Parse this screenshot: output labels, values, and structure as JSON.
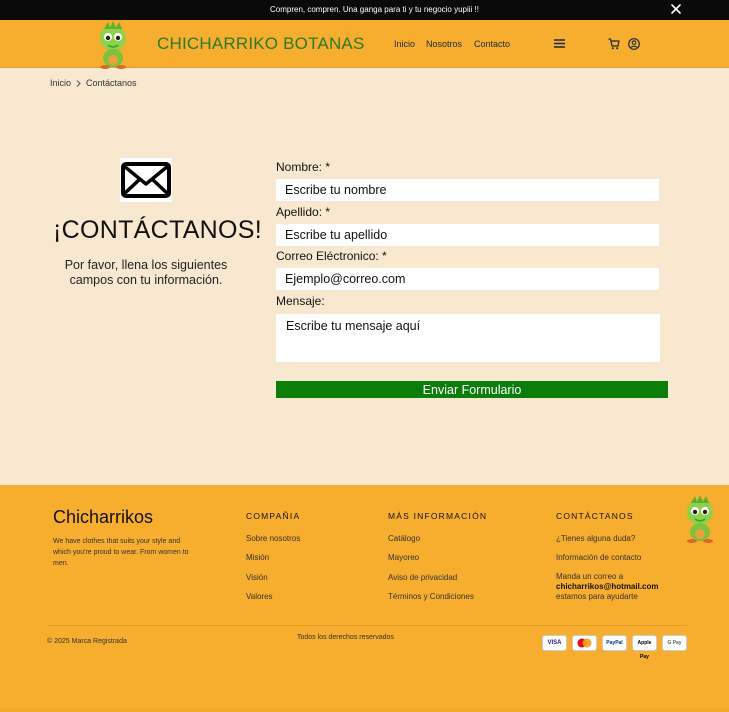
{
  "announcement": {
    "text": "Compren, compren. Una ganga para ti y tu negocio yupiii !!"
  },
  "header": {
    "brand": "CHICHARRIKO BOTANAS",
    "nav": [
      "Inicio",
      "Nosotros",
      "Contacto"
    ]
  },
  "breadcrumb": {
    "home": "Inicio",
    "current": "Contáctanos"
  },
  "contact": {
    "title": "¡CONTÁCTANOS!",
    "subtitle": "Por favor, llena los siguientes campos con tu información."
  },
  "form": {
    "name_label": "Nombre: *",
    "name_placeholder": "Escribe tu nombre",
    "lastname_label": "Apellido: *",
    "lastname_placeholder": "Escribe tu apellido",
    "email_label": "Correo Eléctronico: *",
    "email_placeholder": "Ejemplo@correo.com",
    "message_label": "Mensaje:",
    "message_placeholder": "Escribe tu mensaje aquí",
    "submit_label": "Enviar Formulario"
  },
  "footer": {
    "brand": "Chicharrikos",
    "description": "We have clothes that suits your style and which you're proud to wear. From women to men.",
    "company_heading": "COMPAÑIA",
    "company_links": [
      "Sobre nosotros",
      "Misión",
      "Visión",
      "Valores"
    ],
    "info_heading": "MÁS INFORMACIÓN",
    "info_links": [
      "Catálogo",
      "Mayoreo",
      "Aviso de privacidad",
      "Términos y Condiciones"
    ],
    "contact_heading": "CONTÁCTANOS",
    "contact_links": [
      "¿Tienes alguna duda?",
      "Información de contacto"
    ],
    "mail_line1": "Manda un correo a",
    "mail_email": "chicharrikos@hotmail.com",
    "mail_line3": "estamos para ayudarte",
    "copyright": "© 2025 Marca Registrada",
    "rights": "Todos los derechos reservados",
    "payments": [
      "VISA",
      "Mastercard",
      "PayPal",
      "Apple Pay",
      "G Pay"
    ]
  },
  "colors": {
    "accent": "#f7ad2e",
    "brand_green": "#2d7a26",
    "button_green": "#0a7d0a",
    "background": "#f7e8cf"
  },
  "icons": [
    "close-icon",
    "menu-icon",
    "cart-icon",
    "user-icon",
    "chevron-right-icon",
    "envelope-icon",
    "mascot-logo"
  ]
}
